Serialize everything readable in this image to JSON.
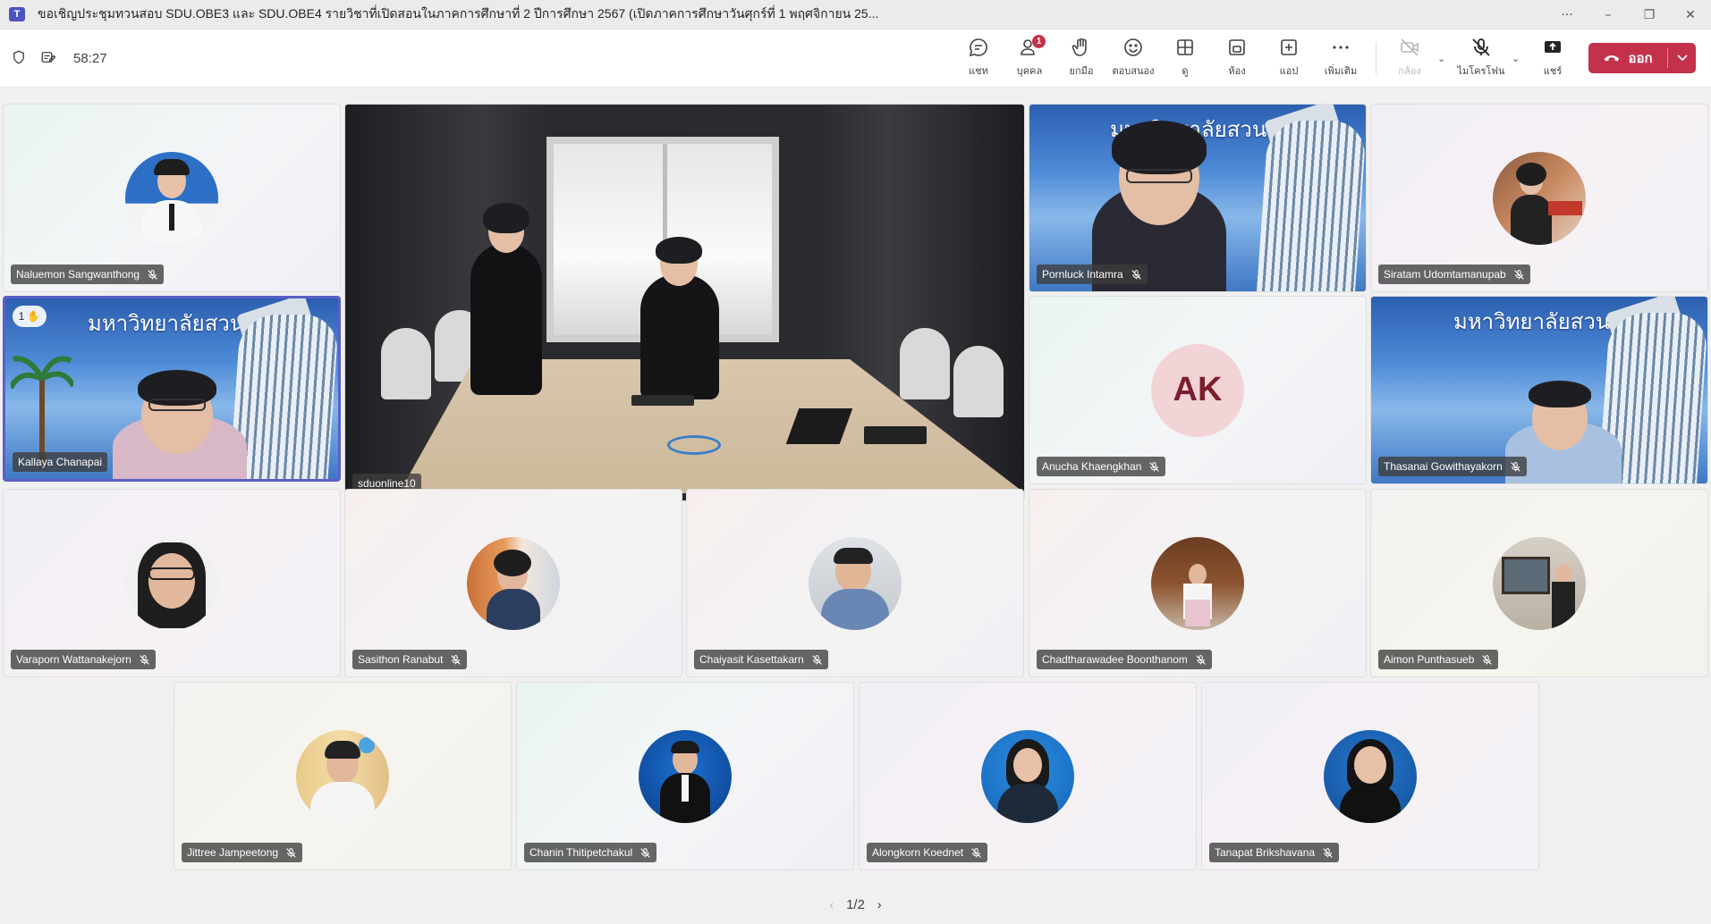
{
  "window": {
    "title": "ขอเชิญประชุมทวนสอบ SDU.OBE3 และ SDU.OBE4 รายวิชาที่เปิดสอนในภาคการศึกษาที่ 2 ปีการศึกษา 2567 (เปิดภาคการศึกษาวันศุกร์ที่ 1 พฤศจิกายน 25...",
    "more": "···",
    "minimize": "–",
    "restore": "❐",
    "close": "✕"
  },
  "toolbar": {
    "timer": "58:27",
    "chat_label": "แชท",
    "people_label": "บุคคล",
    "people_badge": "1",
    "raise_label": "ยกมือ",
    "react_label": "ตอบสนอง",
    "view_label": "ดู",
    "rooms_label": "ห้อง",
    "apps_label": "แอป",
    "more_label": "เพิ่มเติม",
    "camera_label": "กล้อง",
    "mic_label": "ไมโครโฟน",
    "share_label": "แชร์",
    "leave_label": "ออก"
  },
  "banner_text": "มหาวิทยาลัยสวนดุสิต",
  "participants": [
    {
      "name": "Naluemon Sangwanthong"
    },
    {
      "name": "sduonline10"
    },
    {
      "name": "Pornluck Intamra"
    },
    {
      "name": "Siratam Udomtamanupab"
    },
    {
      "name": "Kallaya Chanapai",
      "hand_count": "1"
    },
    {
      "name": "Anucha Khaengkhan",
      "initials": "AK"
    },
    {
      "name": "Thasanai Gowithayakorn"
    },
    {
      "name": "Varaporn Wattanakejorn"
    },
    {
      "name": "Sasithon Ranabut"
    },
    {
      "name": "Chaiyasit Kasettakarn"
    },
    {
      "name": "Chadtharawadee Boonthanom"
    },
    {
      "name": "Aimon Punthasueb"
    },
    {
      "name": "Jittree Jampeetong"
    },
    {
      "name": "Chanin Thitipetchakul"
    },
    {
      "name": "Alongkorn Koednet"
    },
    {
      "name": "Tanapat Brikshavana"
    }
  ],
  "pager": {
    "text": "1/2"
  },
  "colors": {
    "accent": "#5b5fc7",
    "leave": "#c4314b",
    "badge": "#c4314b"
  }
}
